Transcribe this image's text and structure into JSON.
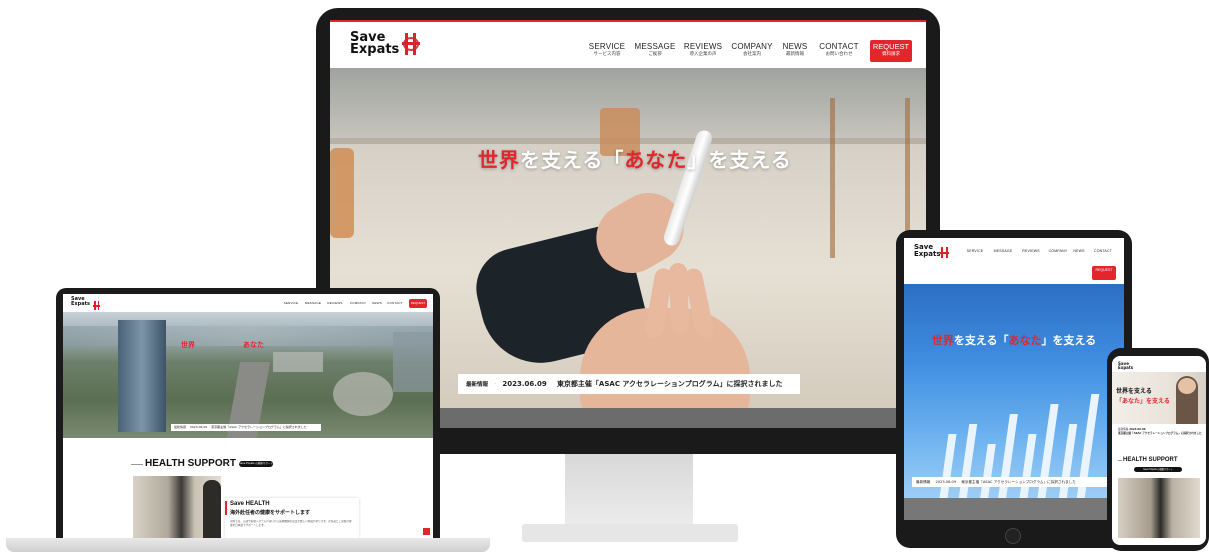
{
  "logo": {
    "line1": "Save",
    "line2": "Expats"
  },
  "nav": [
    {
      "en": "SERVICE",
      "jp": "サービス内容"
    },
    {
      "en": "MESSAGE",
      "jp": "ご挨拶"
    },
    {
      "en": "REVIEWS",
      "jp": "導入企業の声"
    },
    {
      "en": "COMPANY",
      "jp": "会社案内"
    },
    {
      "en": "NEWS",
      "jp": "最新情報"
    },
    {
      "en": "CONTACT",
      "jp": "お問い合わせ"
    }
  ],
  "request": {
    "en": "REQUEST",
    "jp": "資料請求"
  },
  "hero": {
    "part1": "世界",
    "part2": "を支える「",
    "part3": "あなた",
    "part4": "」を支える"
  },
  "news": {
    "label": "最新情報",
    "date": "2023.06.09",
    "text": "東京都主催「ASAC アクセラレーションプログラム」に採択されました"
  },
  "laptop": {
    "hero_fragment1": "世界",
    "hero_fragment2": "あなた",
    "section_title": "HEALTH SUPPORT",
    "section_tag": "Save Expats の健康サポート",
    "card_title": "Save HEALTH",
    "card_subtitle": "海外赴任者の健康をサポートします",
    "card_body": "海外では、言語や医療システムの違いから医療機関の受診が難しい場面があります。赴任者とご家族の健康を日本語でサポートします。"
  },
  "tablet": {
    "hero_line": "世界を支える「あなた」を支える"
  },
  "phone": {
    "hero_line1": "世界を支える",
    "hero_line2": "「あなた」を支える",
    "section_title": "HEALTH SUPPORT",
    "section_tag": "Save Expats の健康サポート"
  },
  "colors": {
    "accent": "#e2262c",
    "device_frame": "#1a1a1a",
    "stand": "#e2e2e2"
  }
}
